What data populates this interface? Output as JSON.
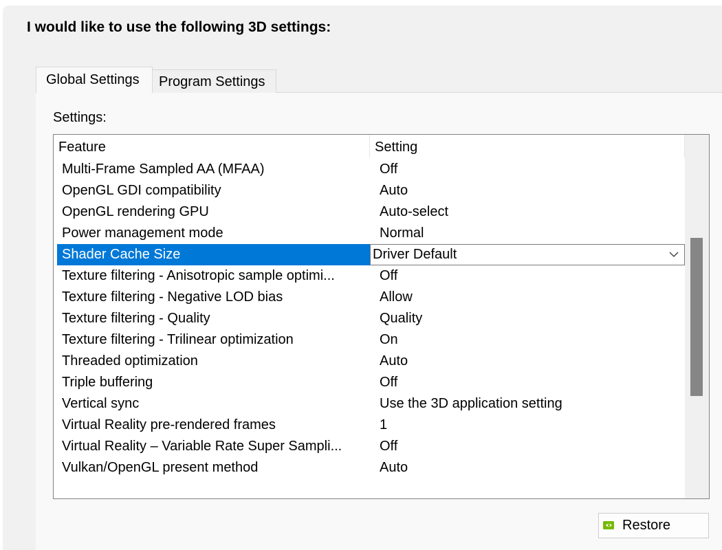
{
  "heading": "I would like to use the following 3D settings:",
  "tabs": [
    {
      "label": "Global Settings",
      "active": true
    },
    {
      "label": "Program Settings",
      "active": false
    }
  ],
  "settings_label": "Settings:",
  "table": {
    "columns": [
      "Feature",
      "Setting"
    ],
    "rows": [
      {
        "feature": "Multi-Frame Sampled AA (MFAA)",
        "setting": "Off"
      },
      {
        "feature": "OpenGL GDI compatibility",
        "setting": "Auto"
      },
      {
        "feature": "OpenGL rendering GPU",
        "setting": "Auto-select"
      },
      {
        "feature": "Power management mode",
        "setting": "Normal"
      },
      {
        "feature": "Shader Cache Size",
        "setting": "Driver Default",
        "selected": true
      },
      {
        "feature": "Texture filtering - Anisotropic sample optimi...",
        "setting": "Off"
      },
      {
        "feature": "Texture filtering - Negative LOD bias",
        "setting": "Allow"
      },
      {
        "feature": "Texture filtering - Quality",
        "setting": "Quality"
      },
      {
        "feature": "Texture filtering - Trilinear optimization",
        "setting": "On"
      },
      {
        "feature": "Threaded optimization",
        "setting": "Auto"
      },
      {
        "feature": "Triple buffering",
        "setting": "Off"
      },
      {
        "feature": "Vertical sync",
        "setting": "Use the 3D application setting"
      },
      {
        "feature": "Virtual Reality pre-rendered frames",
        "setting": "1"
      },
      {
        "feature": "Virtual Reality – Variable Rate Super Sampli...",
        "setting": "Off"
      },
      {
        "feature": "Vulkan/OpenGL present method",
        "setting": "Auto"
      }
    ]
  },
  "scrollbar": {
    "position_fraction": 0.5
  },
  "restore_button": {
    "label": "Restore",
    "icon": "nvidia-logo-icon"
  },
  "colors": {
    "selection": "#0078d7",
    "nvidia_green": "#76b900"
  }
}
